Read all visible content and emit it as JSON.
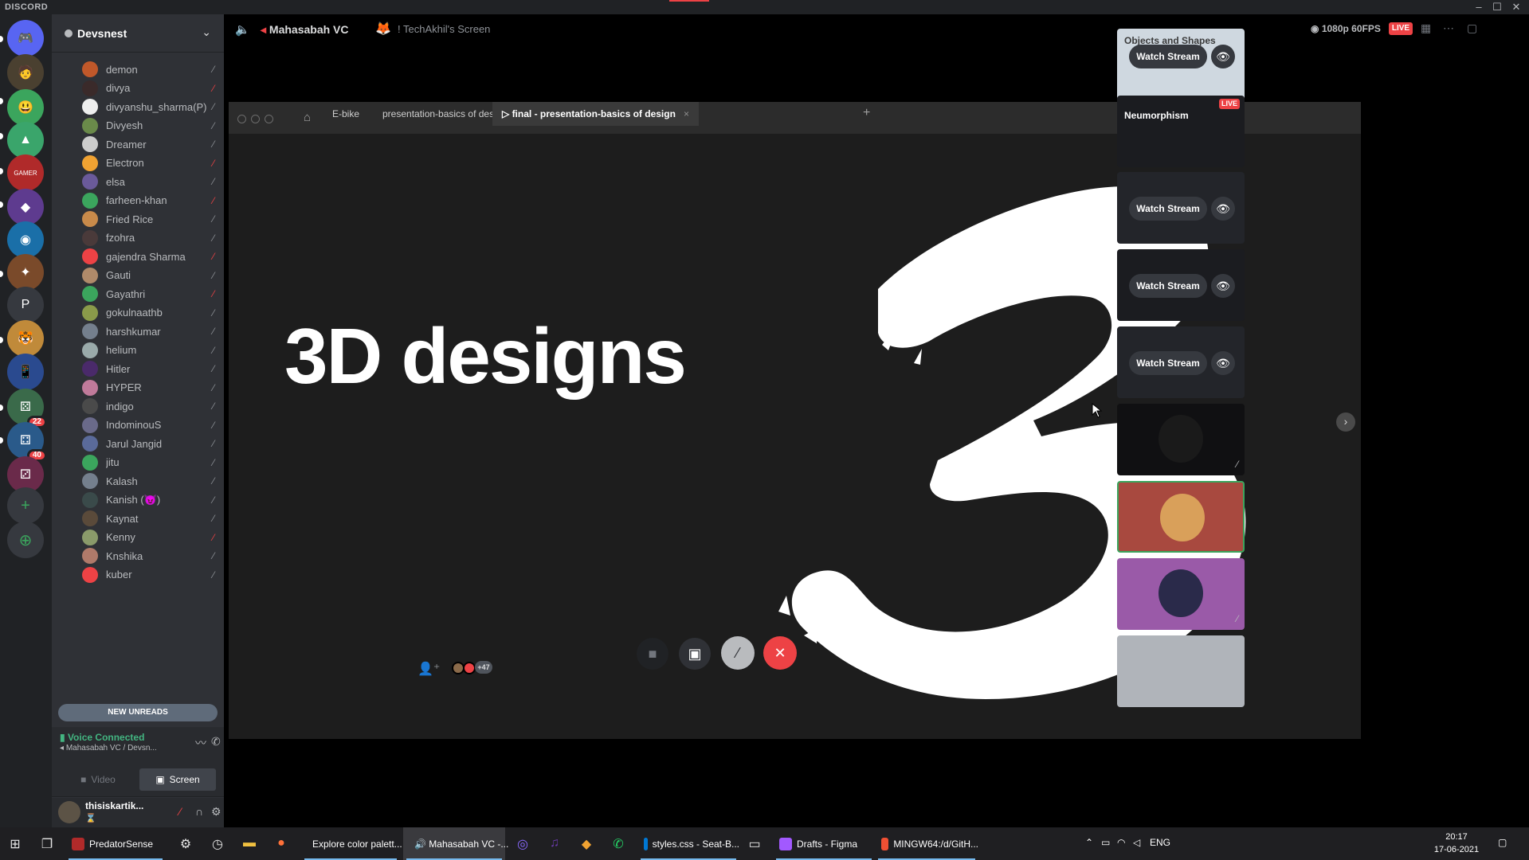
{
  "app": {
    "title": "DISCORD"
  },
  "window": {
    "minimize": "–",
    "maximize": "☐",
    "close": "✕"
  },
  "servers": [
    {
      "name": "home",
      "glyph": "🎮",
      "color": "#5865f2"
    },
    {
      "name": "server-1",
      "glyph": "🧑",
      "color": "#4a4030"
    },
    {
      "name": "server-2",
      "glyph": "😃",
      "color": "#3ba55d"
    },
    {
      "name": "server-3",
      "glyph": "▲",
      "color": "#3aa56b"
    },
    {
      "name": "server-4",
      "glyph": "GAMER",
      "color": "#b02a2a"
    },
    {
      "name": "server-5",
      "glyph": "◆",
      "color": "#5e3b8f"
    },
    {
      "name": "server-6",
      "glyph": "◉",
      "color": "#1a6fa8"
    },
    {
      "name": "server-7",
      "glyph": "✦",
      "color": "#7a4a2a"
    },
    {
      "name": "server-8",
      "glyph": "P",
      "color": "#36393f"
    },
    {
      "name": "server-9",
      "glyph": "🐯",
      "color": "#c08a3a"
    },
    {
      "name": "server-10",
      "glyph": "📱",
      "color": "#2a4a8f"
    },
    {
      "name": "server-folder-1",
      "glyph": "⚄",
      "color": "#3a6a4a",
      "badge": "22"
    },
    {
      "name": "server-folder-2",
      "glyph": "⚃",
      "color": "#2a5a8a",
      "badge": "40"
    },
    {
      "name": "server-folder-3",
      "glyph": "⚂",
      "color": "#6a2a4a"
    }
  ],
  "add_server": "+",
  "explore": "⊕",
  "guild": {
    "name": "Devsnest",
    "chevron": "⌄"
  },
  "members": [
    {
      "name": "demon",
      "color": "#c0582a",
      "muted": false
    },
    {
      "name": "divya",
      "color": "#3a2a2a",
      "muted": true
    },
    {
      "name": "divyanshu_sharma(P)",
      "color": "#eeeeee",
      "muted": false
    },
    {
      "name": "Divyesh",
      "color": "#6a8a4a",
      "muted": false
    },
    {
      "name": "Dreamer",
      "color": "#cccccc",
      "muted": false
    },
    {
      "name": "Electron",
      "color": "#f0a232",
      "muted": true
    },
    {
      "name": "elsa",
      "color": "#6a5a9a",
      "muted": false
    },
    {
      "name": "farheen-khan",
      "color": "#3ba55d",
      "muted": true
    },
    {
      "name": "Fried Rice",
      "color": "#c88a4a",
      "muted": false
    },
    {
      "name": "fzohra",
      "color": "#4a3a3a",
      "muted": false
    },
    {
      "name": "gajendra Sharma",
      "color": "#ed4245",
      "muted": true
    },
    {
      "name": "Gauti",
      "color": "#b08a6a",
      "muted": false
    },
    {
      "name": "Gayathri",
      "color": "#3ba55d",
      "muted": true
    },
    {
      "name": "gokulnaathb",
      "color": "#8a9a4a",
      "muted": false
    },
    {
      "name": "harshkumar",
      "color": "#747f8d",
      "muted": false
    },
    {
      "name": "helium",
      "color": "#9aaaaa",
      "muted": false
    },
    {
      "name": "Hitler",
      "color": "#4a2a6a",
      "muted": false
    },
    {
      "name": "HYPER",
      "color": "#c07a9a",
      "muted": false
    },
    {
      "name": "indigo",
      "color": "#4a4a4a",
      "muted": false
    },
    {
      "name": "IndominouS",
      "color": "#6a6a8a",
      "muted": false
    },
    {
      "name": "Jarul Jangid",
      "color": "#5a6a9a",
      "muted": false
    },
    {
      "name": "jitu",
      "color": "#3ba55d",
      "muted": false
    },
    {
      "name": "Kalash",
      "color": "#747f8d",
      "muted": false
    },
    {
      "name": "Kanish (😈)",
      "color": "#3a4a4a",
      "muted": false
    },
    {
      "name": "Kaynat",
      "color": "#5a4a3a",
      "muted": false
    },
    {
      "name": "Kenny",
      "color": "#8a9a6a",
      "muted": true
    },
    {
      "name": "Knshika",
      "color": "#b07a6a",
      "muted": false
    },
    {
      "name": "kuber",
      "color": "#ed4245",
      "muted": false
    }
  ],
  "new_unreads": "NEW UNREADS",
  "voice": {
    "status": "Voice Connected",
    "channel": "Mahasabah VC / Devsn...",
    "video_label": "Video",
    "screen_label": "Screen"
  },
  "user": {
    "name": "thisiskartik...",
    "status": "⌛"
  },
  "stage": {
    "channel": "Mahasabah VC",
    "screen": "! TechAkhil's Screen",
    "quality": "1080p 60FPS",
    "live": "LIVE"
  },
  "browser": {
    "tabs": [
      "E-bike",
      "presentation-basics of design",
      "final - presentation-basics of design"
    ],
    "active_tab": 2,
    "close": "×",
    "plus": "+"
  },
  "slide": {
    "title": "3D designs",
    "numeral": "3"
  },
  "tiles": [
    {
      "title": "Objects and Shapes",
      "watch": "Watch Stream",
      "live": false
    },
    {
      "title": "Neumorphism",
      "watch": "",
      "live": true,
      "live_label": "LIVE"
    },
    {
      "title": "",
      "watch": "Watch Stream",
      "live": false
    },
    {
      "title": "",
      "watch": "Watch Stream",
      "live": false
    },
    {
      "title": "",
      "watch": "Watch Stream",
      "live": false
    },
    {
      "title": "",
      "watch": "",
      "live": false
    },
    {
      "title": "",
      "watch": "",
      "live": false
    },
    {
      "title": "",
      "watch": "",
      "live": false
    },
    {
      "title": "",
      "watch": "",
      "live": false
    }
  ],
  "participants_more": "+47",
  "taskbar": {
    "apps": [
      {
        "label": "PredatorSense",
        "color": "#b02a2a",
        "active": false
      },
      {
        "label": "Explore color palett...",
        "color": "#fb542b",
        "active": false
      },
      {
        "label": "🔊 Mahasabah VC -...",
        "color": "#5865f2",
        "active": true
      },
      {
        "label": "styles.css - Seat-B...",
        "color": "#0078d4",
        "active": false
      },
      {
        "label": "Drafts - Figma",
        "color": "#a259ff",
        "active": false
      },
      {
        "label": "MINGW64:/d/GitH...",
        "color": "#f05033",
        "active": false
      }
    ],
    "lang": "ENG",
    "time": "20:17",
    "date": "17-06-2021"
  }
}
